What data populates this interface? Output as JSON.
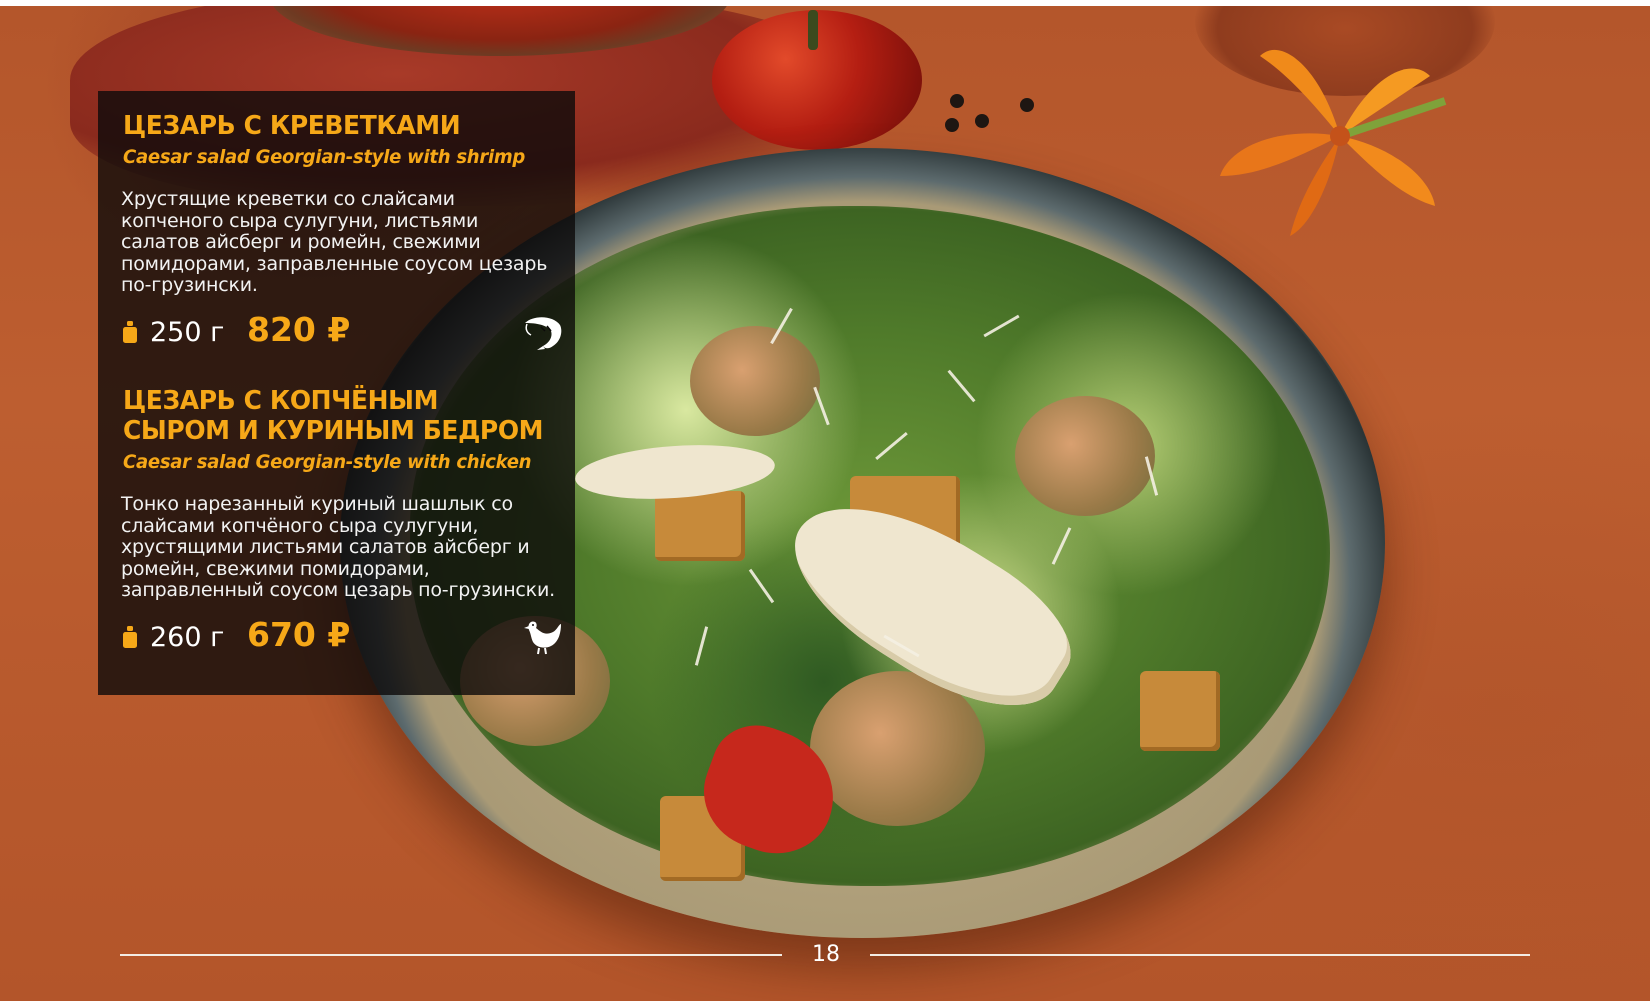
{
  "menu_items": [
    {
      "title_ru": "ЦЕЗАРЬ С КРЕВЕТКАМИ",
      "title_en": "Caesar salad Georgian-style with shrimp",
      "description": "Хрустящие креветки со слайсами копченого сыра сулугуни, листьями салатов айсберг и ромейн, свежими помидорами, заправленные соусом цезарь по-грузински.",
      "weight": "250 г",
      "price": "820 ₽",
      "icon": "shrimp-icon"
    },
    {
      "title_ru": "ЦЕЗАРЬ С КОПЧЁНЫМ СЫРОМ И КУРИНЫМ БЕДРОМ",
      "title_en": "Caesar salad Georgian-style with chicken",
      "description": "Тонко нарезанный куриный шашлык со слайсами копчёного сыра сулугуни, хрустящими листьями салатов айсберг и ромейн, свежими помидорами, заправленный соусом цезарь по-грузински.",
      "weight": "260 г",
      "price": "670 ₽",
      "icon": "chicken-icon"
    }
  ],
  "page_number": "18",
  "colors": {
    "accent": "#f6a818",
    "panel_background": "#0c0a0a",
    "text": "#f2f2f2",
    "background": "#b85a2d"
  }
}
